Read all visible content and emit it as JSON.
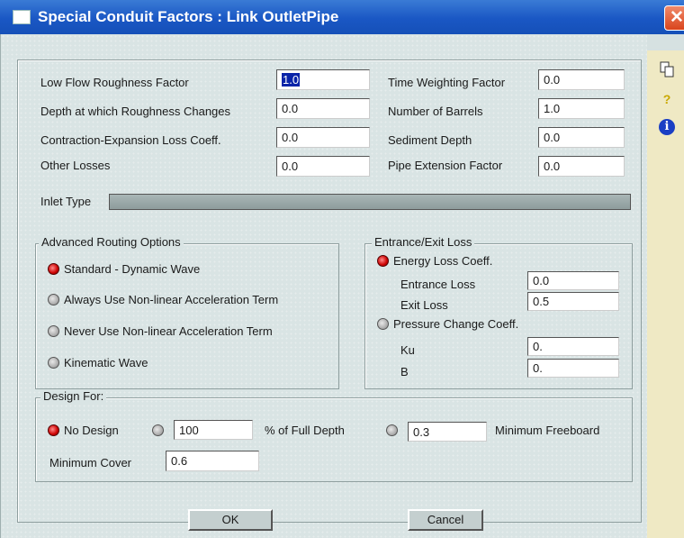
{
  "window": {
    "title": "Special Conduit Factors : Link OutletPipe",
    "close": "✕"
  },
  "sidebar": {
    "copy_icon": "copy-icon",
    "help_icon": "question-icon",
    "info_icon": "info-icon",
    "help_glyph": "?",
    "info_glyph": "i"
  },
  "fields": {
    "low_flow_label": "Low Flow Roughness Factor",
    "low_flow_value": "1.0",
    "depth_label": "Depth at which Roughness Changes",
    "depth_value": "0.0",
    "contraction_label": "Contraction-Expansion Loss Coeff.",
    "contraction_value": "0.0",
    "other_label": "Other Losses",
    "other_value": "0.0",
    "time_label": "Time Weighting Factor",
    "time_value": "0.0",
    "barrels_label": "Number of Barrels",
    "barrels_value": "1.0",
    "sediment_label": "Sediment Depth",
    "sediment_value": "0.0",
    "pipe_ext_label": "Pipe Extension Factor",
    "pipe_ext_value": "0.0",
    "inlet_label": "Inlet Type",
    "inlet_value": ""
  },
  "routing": {
    "title": "Advanced Routing Options",
    "options": [
      "Standard - Dynamic Wave",
      "Always Use Non-linear Acceleration Term",
      "Never Use Non-linear Acceleration Term",
      "Kinematic Wave"
    ],
    "selected": 0
  },
  "entrance": {
    "title": "Entrance/Exit Loss",
    "energy_label": "Energy Loss Coeff.",
    "energy_selected": true,
    "entrance_label": "Entrance Loss",
    "entrance_value": "0.0",
    "exit_label": "Exit Loss",
    "exit_value": "0.5",
    "pressure_label": "Pressure Change Coeff.",
    "ku_label": "Ku",
    "ku_value": "0.",
    "b_label": "B",
    "b_value": "0."
  },
  "design": {
    "title": "Design For:",
    "no_design_label": "No Design",
    "no_design_selected": true,
    "percent_value": "100",
    "percent_label": "% of Full Depth",
    "freeboard_value": "0.3",
    "freeboard_label": "Minimum Freeboard",
    "cover_label": "Minimum Cover",
    "cover_value": "0.6"
  },
  "buttons": {
    "ok": "OK",
    "cancel": "Cancel"
  }
}
